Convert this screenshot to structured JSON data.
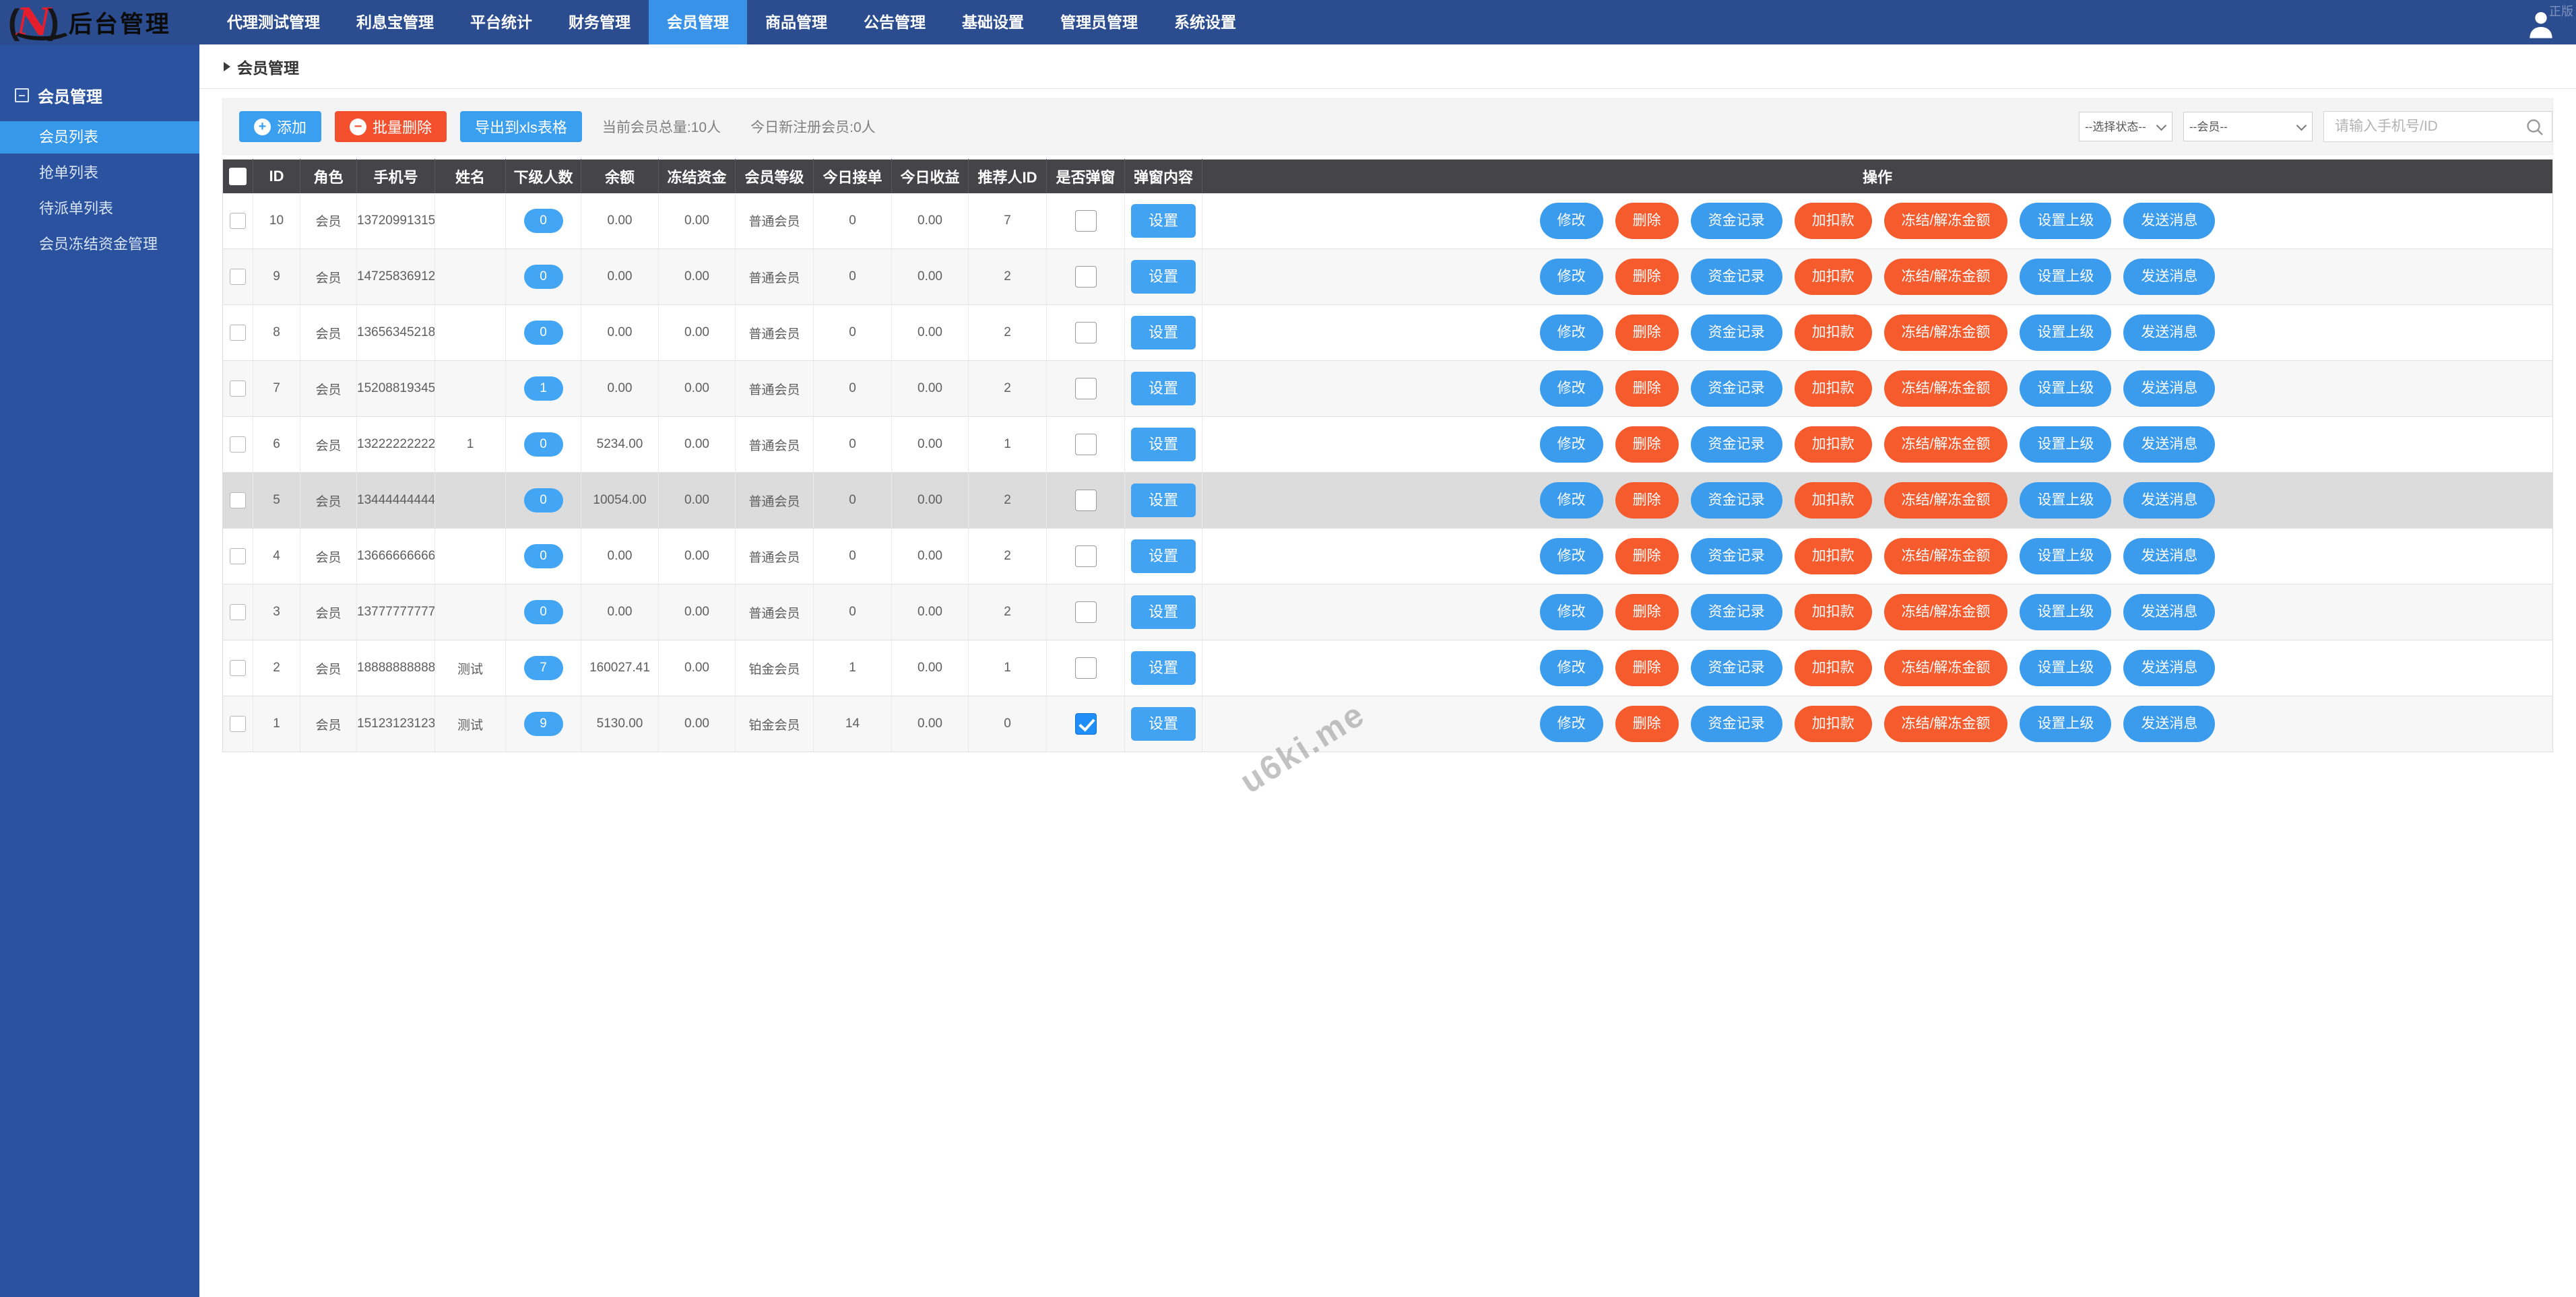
{
  "colors": {
    "accent_blue": "#3b9ff0",
    "accent_orange": "#f4502e",
    "pill_orange": "#f65b2e",
    "nav_bg": "#2b4d8f",
    "nav_active": "#3893e8",
    "sidebar_bg": "#2b529e",
    "sidebar_active": "#3798ea",
    "table_header_bg": "#454549",
    "row_highlight": "#dcdcdc"
  },
  "navbar": {
    "logo": {
      "paren_open": "(",
      "glyph": "N",
      "paren_close": ")",
      "title": "后台管理"
    },
    "items": [
      {
        "label": "代理测试管理"
      },
      {
        "label": "利息宝管理"
      },
      {
        "label": "平台统计"
      },
      {
        "label": "财务管理"
      },
      {
        "label": "会员管理",
        "active": true
      },
      {
        "label": "商品管理"
      },
      {
        "label": "公告管理"
      },
      {
        "label": "基础设置"
      },
      {
        "label": "管理员管理"
      },
      {
        "label": "系统设置"
      }
    ],
    "corner_text": "正版"
  },
  "sidebar": {
    "section": {
      "label": "会员管理",
      "collapse_glyph": "–"
    },
    "items": [
      {
        "label": "会员列表",
        "active": true
      },
      {
        "label": "抢单列表"
      },
      {
        "label": "待派单列表"
      },
      {
        "label": "会员冻结资金管理"
      }
    ]
  },
  "breadcrumb": {
    "label": "会员管理"
  },
  "toolbar": {
    "add_label": "添加",
    "add_icon_glyph": "+",
    "batch_delete_label": "批量删除",
    "batch_delete_icon_glyph": "−",
    "export_label": "导出到xls表格",
    "stats_total": "当前会员总量:10人",
    "stats_new_today": "今日新注册会员:0人",
    "status_select_value": "--选择状态--",
    "member_select_value": "--会员--",
    "search_placeholder": "请输入手机号/ID"
  },
  "table": {
    "headers": [
      "ID",
      "角色",
      "手机号",
      "姓名",
      "下级人数",
      "余额",
      "冻结资金",
      "会员等级",
      "今日接单",
      "今日收益",
      "推荐人ID",
      "是否弹窗",
      "弹窗内容",
      "操作"
    ],
    "popup_set_label": "设置",
    "action_buttons": [
      {
        "name": "modify",
        "label": "修改",
        "color": "blue"
      },
      {
        "name": "delete",
        "label": "删除",
        "color": "orange"
      },
      {
        "name": "funds-record",
        "label": "资金记录",
        "color": "blue"
      },
      {
        "name": "add-deduct",
        "label": "加扣款",
        "color": "orange"
      },
      {
        "name": "freeze-unfreeze",
        "label": "冻结/解冻金额",
        "color": "orange"
      },
      {
        "name": "set-parent",
        "label": "设置上级",
        "color": "blue"
      },
      {
        "name": "send-message",
        "label": "发送消息",
        "color": "blue"
      }
    ],
    "rows": [
      {
        "id": "10",
        "role": "会员",
        "phone": "13720991315",
        "name": "",
        "sub_count": "0",
        "balance": "0.00",
        "frozen": "0.00",
        "level": "普通会员",
        "today_orders": "0",
        "today_income": "0.00",
        "referrer_id": "7",
        "popup_checked": false,
        "highlighted": false
      },
      {
        "id": "9",
        "role": "会员",
        "phone": "14725836912",
        "name": "",
        "sub_count": "0",
        "balance": "0.00",
        "frozen": "0.00",
        "level": "普通会员",
        "today_orders": "0",
        "today_income": "0.00",
        "referrer_id": "2",
        "popup_checked": false,
        "highlighted": false
      },
      {
        "id": "8",
        "role": "会员",
        "phone": "13656345218",
        "name": "",
        "sub_count": "0",
        "balance": "0.00",
        "frozen": "0.00",
        "level": "普通会员",
        "today_orders": "0",
        "today_income": "0.00",
        "referrer_id": "2",
        "popup_checked": false,
        "highlighted": false
      },
      {
        "id": "7",
        "role": "会员",
        "phone": "15208819345",
        "name": "",
        "sub_count": "1",
        "balance": "0.00",
        "frozen": "0.00",
        "level": "普通会员",
        "today_orders": "0",
        "today_income": "0.00",
        "referrer_id": "2",
        "popup_checked": false,
        "highlighted": false
      },
      {
        "id": "6",
        "role": "会员",
        "phone": "13222222222",
        "name": "1",
        "sub_count": "0",
        "balance": "5234.00",
        "frozen": "0.00",
        "level": "普通会员",
        "today_orders": "0",
        "today_income": "0.00",
        "referrer_id": "1",
        "popup_checked": false,
        "highlighted": false
      },
      {
        "id": "5",
        "role": "会员",
        "phone": "13444444444",
        "name": "",
        "sub_count": "0",
        "balance": "10054.00",
        "frozen": "0.00",
        "level": "普通会员",
        "today_orders": "0",
        "today_income": "0.00",
        "referrer_id": "2",
        "popup_checked": false,
        "highlighted": true
      },
      {
        "id": "4",
        "role": "会员",
        "phone": "13666666666",
        "name": "",
        "sub_count": "0",
        "balance": "0.00",
        "frozen": "0.00",
        "level": "普通会员",
        "today_orders": "0",
        "today_income": "0.00",
        "referrer_id": "2",
        "popup_checked": false,
        "highlighted": false
      },
      {
        "id": "3",
        "role": "会员",
        "phone": "13777777777",
        "name": "",
        "sub_count": "0",
        "balance": "0.00",
        "frozen": "0.00",
        "level": "普通会员",
        "today_orders": "0",
        "today_income": "0.00",
        "referrer_id": "2",
        "popup_checked": false,
        "highlighted": false
      },
      {
        "id": "2",
        "role": "会员",
        "phone": "18888888888",
        "name": "测试",
        "sub_count": "7",
        "balance": "160027.41",
        "frozen": "0.00",
        "level": "铂金会员",
        "today_orders": "1",
        "today_income": "0.00",
        "referrer_id": "1",
        "popup_checked": false,
        "highlighted": false
      },
      {
        "id": "1",
        "role": "会员",
        "phone": "15123123123",
        "name": "测试",
        "sub_count": "9",
        "balance": "5130.00",
        "frozen": "0.00",
        "level": "铂金会员",
        "today_orders": "14",
        "today_income": "0.00",
        "referrer_id": "0",
        "popup_checked": true,
        "highlighted": false
      }
    ]
  },
  "watermark": "u6ki.me"
}
